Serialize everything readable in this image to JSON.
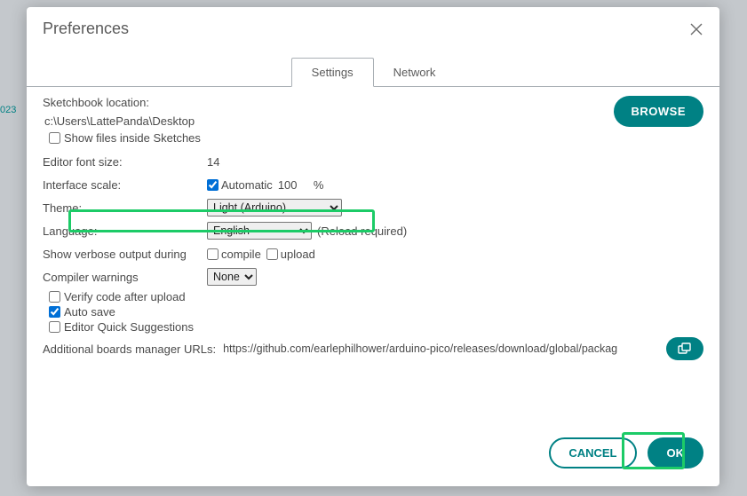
{
  "bg_partial": "023",
  "title": "Preferences",
  "tabs": {
    "settings": "Settings",
    "network": "Network"
  },
  "sketchbook": {
    "label": "Sketchbook location:",
    "path": "c:\\Users\\LattePanda\\Desktop",
    "browse": "BROWSE",
    "show_files": "Show files inside Sketches",
    "show_files_checked": false
  },
  "font": {
    "label": "Editor font size:",
    "value": "14"
  },
  "scale": {
    "label": "Interface scale:",
    "auto": "Automatic",
    "auto_checked": true,
    "value": "100",
    "unit": "%"
  },
  "theme": {
    "label": "Theme:",
    "value": "Light (Arduino)"
  },
  "lang": {
    "label": "Language:",
    "value": "English",
    "note": "(Reload required)"
  },
  "verbose": {
    "label": "Show verbose output during",
    "compile": "compile",
    "upload": "upload",
    "compile_checked": false,
    "upload_checked": false
  },
  "warnings": {
    "label": "Compiler warnings",
    "value": "None"
  },
  "opts": {
    "verify": "Verify code after upload",
    "verify_checked": false,
    "autosave": "Auto save",
    "autosave_checked": true,
    "quick": "Editor Quick Suggestions",
    "quick_checked": false
  },
  "urls": {
    "label": "Additional boards manager URLs:",
    "value": "https://github.com/earlephilhower/arduino-pico/releases/download/global/packag"
  },
  "buttons": {
    "cancel": "CANCEL",
    "ok": "OK"
  },
  "colors": {
    "accent": "#008184",
    "highlight": "#1ccb67"
  }
}
